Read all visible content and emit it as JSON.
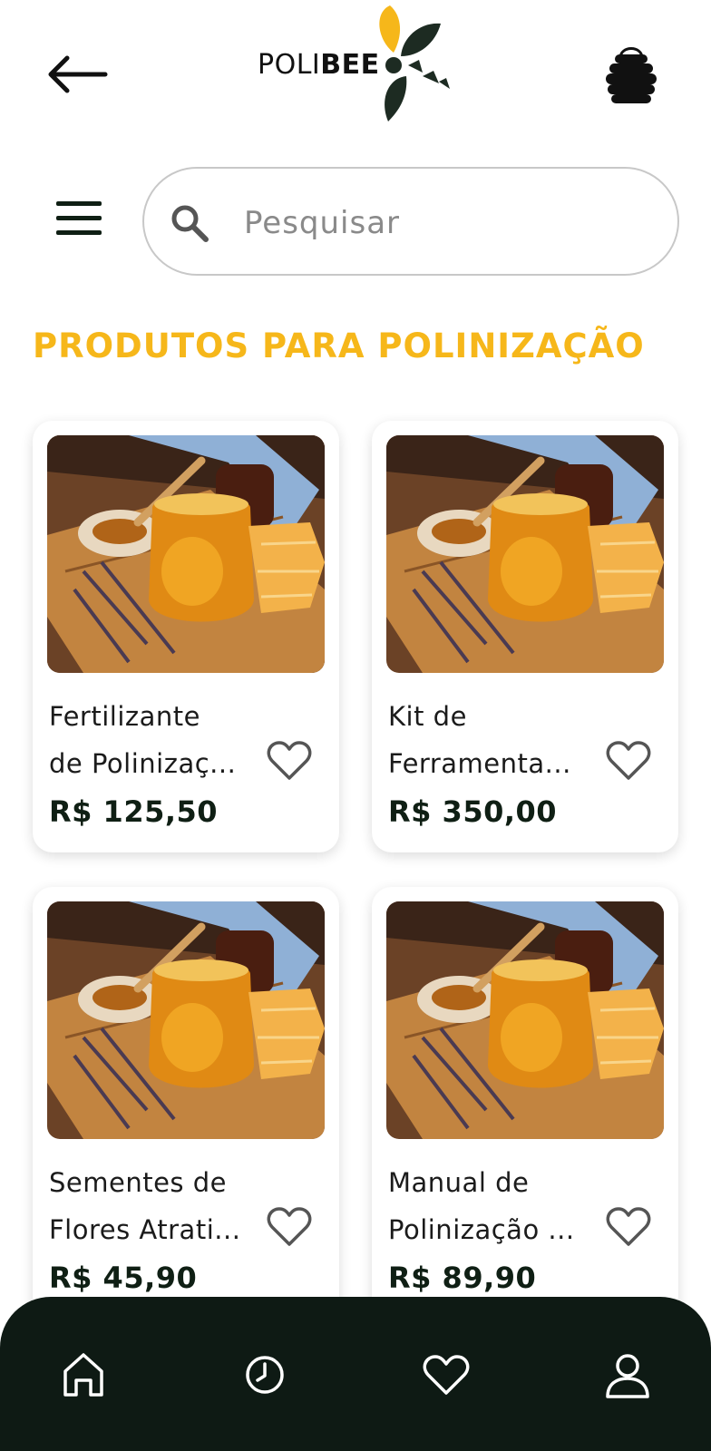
{
  "header": {
    "back_icon": "arrow-left-icon",
    "logo": {
      "text_light": "POLI",
      "text_bold": "BEE"
    },
    "cart_icon": "beehive-bag-icon"
  },
  "search": {
    "menu_icon": "hamburger-menu-icon",
    "icon": "search-icon",
    "placeholder": "Pesquisar"
  },
  "section": {
    "title": "PRODUTOS PARA POLINIZAÇÃO"
  },
  "products": [
    {
      "name_line1": "Fertilizante",
      "name_line2": "de Polinizaç...",
      "price": "R$ 125,50",
      "favorite_icon": "heart-outline-icon"
    },
    {
      "name_line1": "Kit de",
      "name_line2": "Ferramenta...",
      "price": "R$ 350,00",
      "favorite_icon": "heart-outline-icon"
    },
    {
      "name_line1": "Sementes de",
      "name_line2": "Flores Atrati...",
      "price": "R$ 45,90",
      "favorite_icon": "heart-outline-icon"
    },
    {
      "name_line1": "Manual de",
      "name_line2": "Polinização ...",
      "price": "R$ 89,90",
      "favorite_icon": "heart-outline-icon"
    }
  ],
  "bottom_nav": [
    {
      "icon": "home-icon"
    },
    {
      "icon": "clock-icon"
    },
    {
      "icon": "heart-icon"
    },
    {
      "icon": "user-icon"
    }
  ],
  "colors": {
    "accent": "#f6b71a",
    "dark": "#0e1a14",
    "price": "#0f1f14",
    "logo_leaf": "#1d2b22"
  }
}
